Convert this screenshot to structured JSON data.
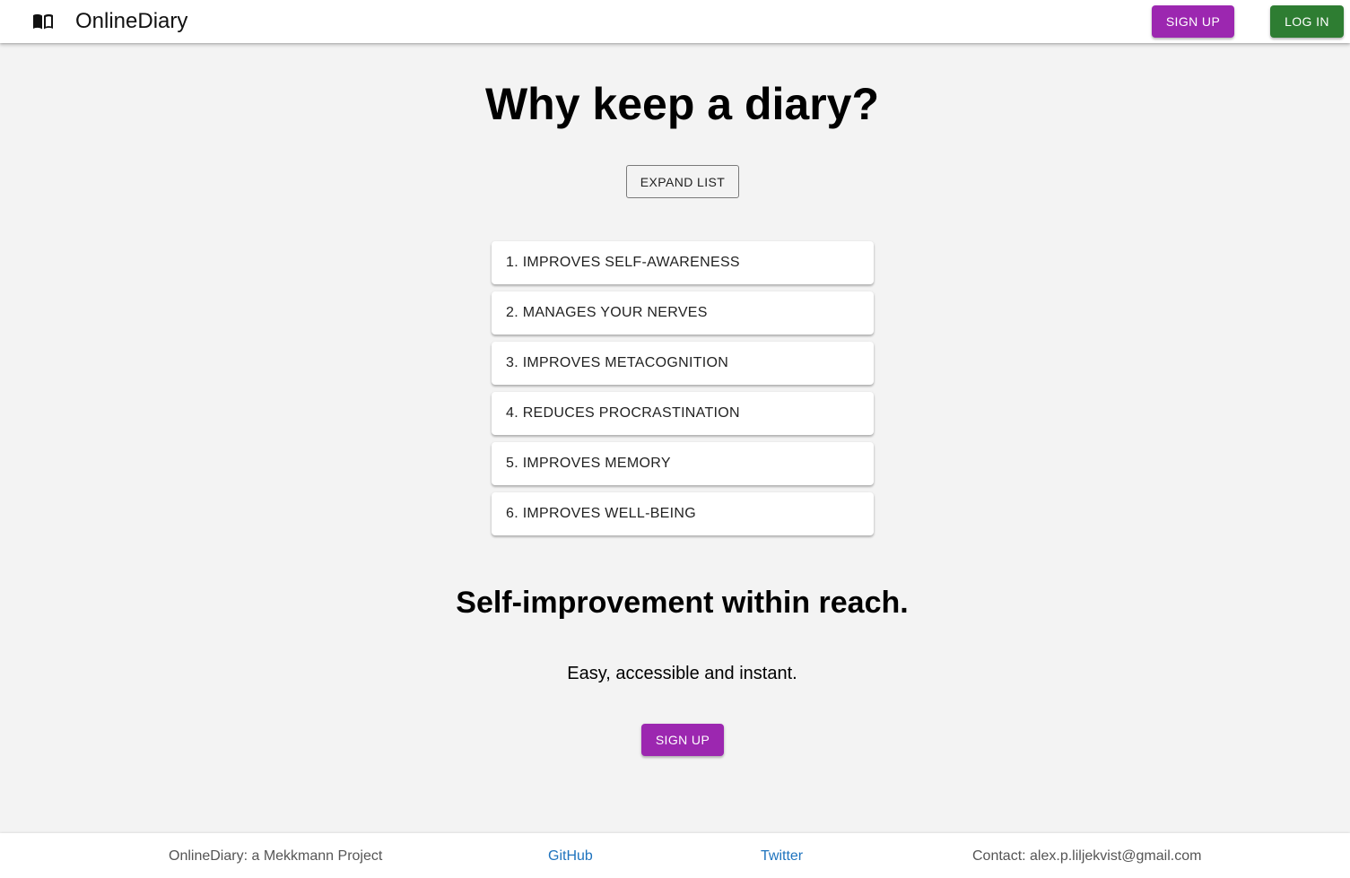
{
  "appbar": {
    "brand_icon": "open-book-icon",
    "title": "OnlineDiary",
    "signup_label": "SIGN UP",
    "login_label": "LOG IN"
  },
  "main": {
    "heading": "Why keep a diary?",
    "expand_label": "EXPAND LIST",
    "reasons": [
      "1. IMPROVES SELF-AWARENESS",
      "2. MANAGES YOUR NERVES",
      "3. IMPROVES METACOGNITION",
      "4. REDUCES PROCRASTINATION",
      "5. IMPROVES MEMORY",
      "6. IMPROVES WELL-BEING"
    ],
    "subheading": "Self-improvement within reach.",
    "tagline": "Easy, accessible and instant.",
    "cta_label": "SIGN UP"
  },
  "footer": {
    "project": "OnlineDiary: a Mekkmann Project",
    "github": "GitHub",
    "twitter": "Twitter",
    "contact": "Contact: alex.p.liljekvist@gmail.com"
  },
  "colors": {
    "signup": "#9c27b0",
    "login": "#2e7d32",
    "background": "#f3f3f3",
    "link": "#1e73be"
  }
}
